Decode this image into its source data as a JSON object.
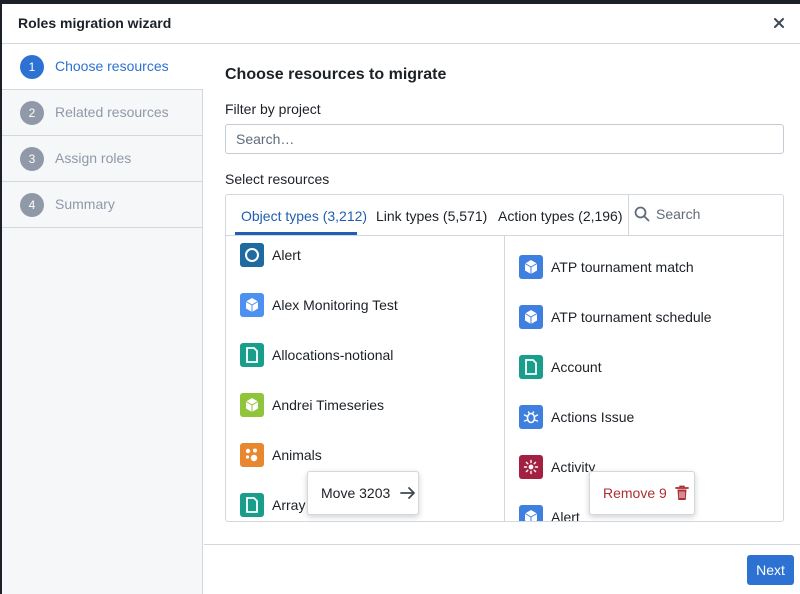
{
  "dialog": {
    "title": "Roles migration wizard",
    "close_icon": "close-icon"
  },
  "steps": [
    {
      "num": "1",
      "label": "Choose resources",
      "active": true
    },
    {
      "num": "2",
      "label": "Related resources",
      "active": false
    },
    {
      "num": "3",
      "label": "Assign roles",
      "active": false
    },
    {
      "num": "4",
      "label": "Summary",
      "active": false
    }
  ],
  "main": {
    "title": "Choose resources to migrate",
    "filter_label": "Filter by project",
    "search_placeholder": "Search…",
    "select_label": "Select resources"
  },
  "tabs": [
    {
      "label": "Object types (3,212)",
      "active": true
    },
    {
      "label": "Link types (5,571)",
      "active": false
    },
    {
      "label": "Action types (2,196)",
      "active": false
    }
  ],
  "tab_search_label": "Search",
  "left_list": [
    {
      "label": "Alert",
      "icon": "circle-icon",
      "color": "#1f6a9e"
    },
    {
      "label": "Alex Monitoring Test",
      "icon": "cube-icon",
      "color": "#4c90f0"
    },
    {
      "label": "Allocations-notional",
      "icon": "document-icon",
      "color": "#1a9e8c"
    },
    {
      "label": "Andrei Timeseries",
      "icon": "cube-icon",
      "color": "#8fc43b"
    },
    {
      "label": "Animals",
      "icon": "paw-icon",
      "color": "#e8872f"
    },
    {
      "label": "Array F",
      "icon": "document-icon",
      "color": "#1a9e8c"
    }
  ],
  "right_list": [
    {
      "label": "ATP tournament match",
      "icon": "cube-icon",
      "color": "#3f7fe0"
    },
    {
      "label": "ATP tournament schedule",
      "icon": "cube-icon",
      "color": "#3f7fe0"
    },
    {
      "label": "Account",
      "icon": "document-icon",
      "color": "#1a9e8c"
    },
    {
      "label": "Actions Issue",
      "icon": "bug-icon",
      "color": "#3f7fe0"
    },
    {
      "label": "Activity",
      "icon": "sun-icon",
      "color": "#a32040"
    },
    {
      "label": "Alert",
      "icon": "cube-icon",
      "color": "#3f7fe0"
    }
  ],
  "move_button": {
    "label": "Move 3203",
    "icon": "arrow-right-icon"
  },
  "remove_button": {
    "label": "Remove 9",
    "icon": "trash-icon"
  },
  "footer": {
    "next_label": "Next"
  },
  "colors": {
    "accent": "#2d72d2",
    "danger": "#ac2f33",
    "sidebar_bg": "#f6f7f9"
  }
}
